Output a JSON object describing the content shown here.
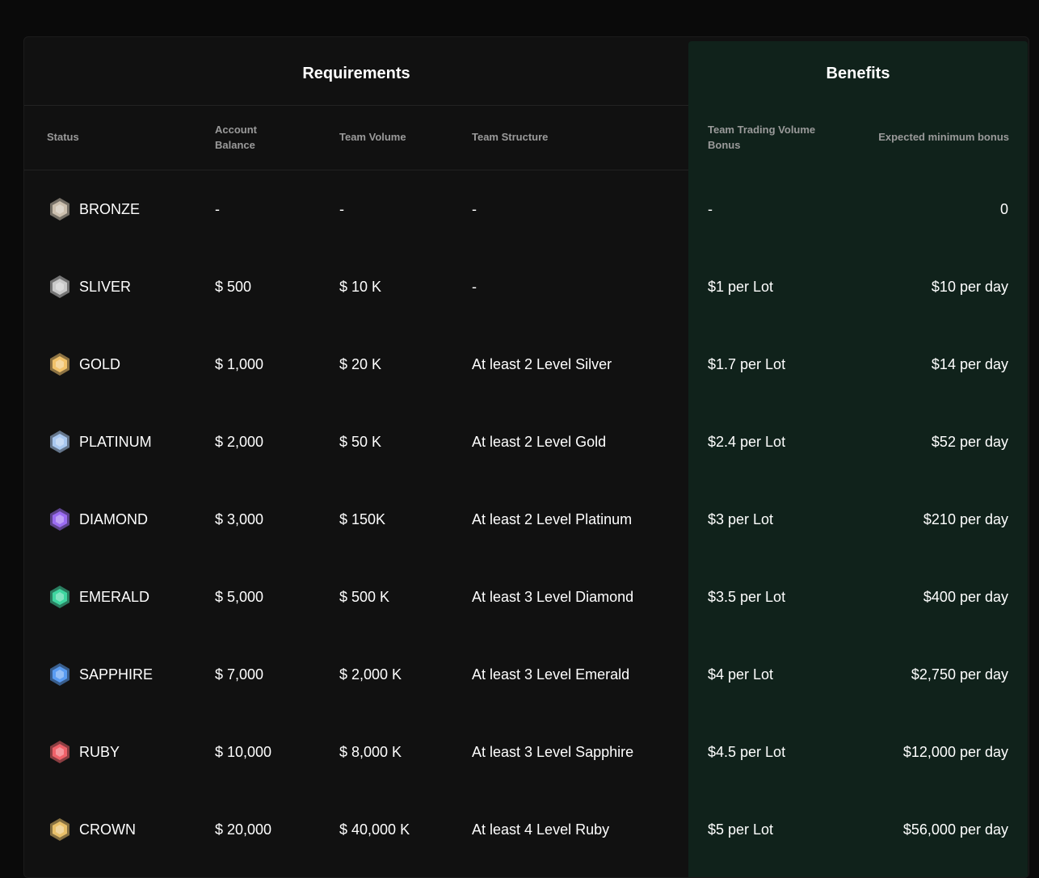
{
  "sections": {
    "requirements_title": "Requirements",
    "benefits_title": "Benefits"
  },
  "columns": {
    "status": "Status",
    "account_balance": "Account Balance",
    "team_volume": "Team Volume",
    "team_structure": "Team Structure",
    "trading_bonus": "Team Trading Volume Bonus",
    "min_bonus": "Expected minimum bonus"
  },
  "rows": [
    {
      "status": "BRONZE",
      "icon": "bronze-badge-icon",
      "color": "#cbbfae",
      "balance": "-",
      "volume": "-",
      "structure": "-",
      "bonus": "-",
      "min_bonus": "0"
    },
    {
      "status": "SLIVER",
      "icon": "silver-badge-icon",
      "color": "#c9c9c9",
      "balance": "$ 500",
      "volume": "$ 10 K",
      "structure": "-",
      "bonus": "$1 per Lot",
      "min_bonus": "$10 per day"
    },
    {
      "status": "GOLD",
      "icon": "gold-badge-icon",
      "color": "#f2c36b",
      "balance": "$ 1,000",
      "volume": "$ 20 K",
      "structure": "At least 2 Level Silver",
      "bonus": "$1.7 per Lot",
      "min_bonus": "$14 per day"
    },
    {
      "status": "PLATINUM",
      "icon": "platinum-badge-icon",
      "color": "#a9c8f0",
      "balance": "$ 2,000",
      "volume": "$ 50 K",
      "structure": "At least 2 Level Gold",
      "bonus": "$2.4 per Lot",
      "min_bonus": "$52 per day"
    },
    {
      "status": "DIAMOND",
      "icon": "diamond-badge-icon",
      "color": "#9b6cf2",
      "balance": "$ 3,000",
      "volume": "$ 150K",
      "structure": "At least 2 Level Platinum",
      "bonus": "$3 per Lot",
      "min_bonus": "$210 per day"
    },
    {
      "status": "EMERALD",
      "icon": "emerald-badge-icon",
      "color": "#3fd6a0",
      "balance": "$ 5,000",
      "volume": "$ 500 K",
      "structure": "At least 3 Level Diamond",
      "bonus": "$3.5 per Lot",
      "min_bonus": "$400 per day"
    },
    {
      "status": "SAPPHIRE",
      "icon": "sapphire-badge-icon",
      "color": "#5a9cf2",
      "balance": "$ 7,000",
      "volume": "$ 2,000 K",
      "structure": "At least 3 Level Emerald",
      "bonus": "$4 per Lot",
      "min_bonus": "$2,750 per day"
    },
    {
      "status": "RUBY",
      "icon": "ruby-badge-icon",
      "color": "#f0626a",
      "balance": "$ 10,000",
      "volume": "$ 8,000 K",
      "structure": "At least 3 Level Sapphire",
      "bonus": "$4.5 per Lot",
      "min_bonus": "$12,000 per day"
    },
    {
      "status": "CROWN",
      "icon": "crown-badge-icon",
      "color": "#e8c06a",
      "balance": "$ 20,000",
      "volume": "$ 40,000 K",
      "structure": "At least 4 Level Ruby",
      "bonus": "$5 per Lot",
      "min_bonus": "$56,000 per day"
    }
  ]
}
